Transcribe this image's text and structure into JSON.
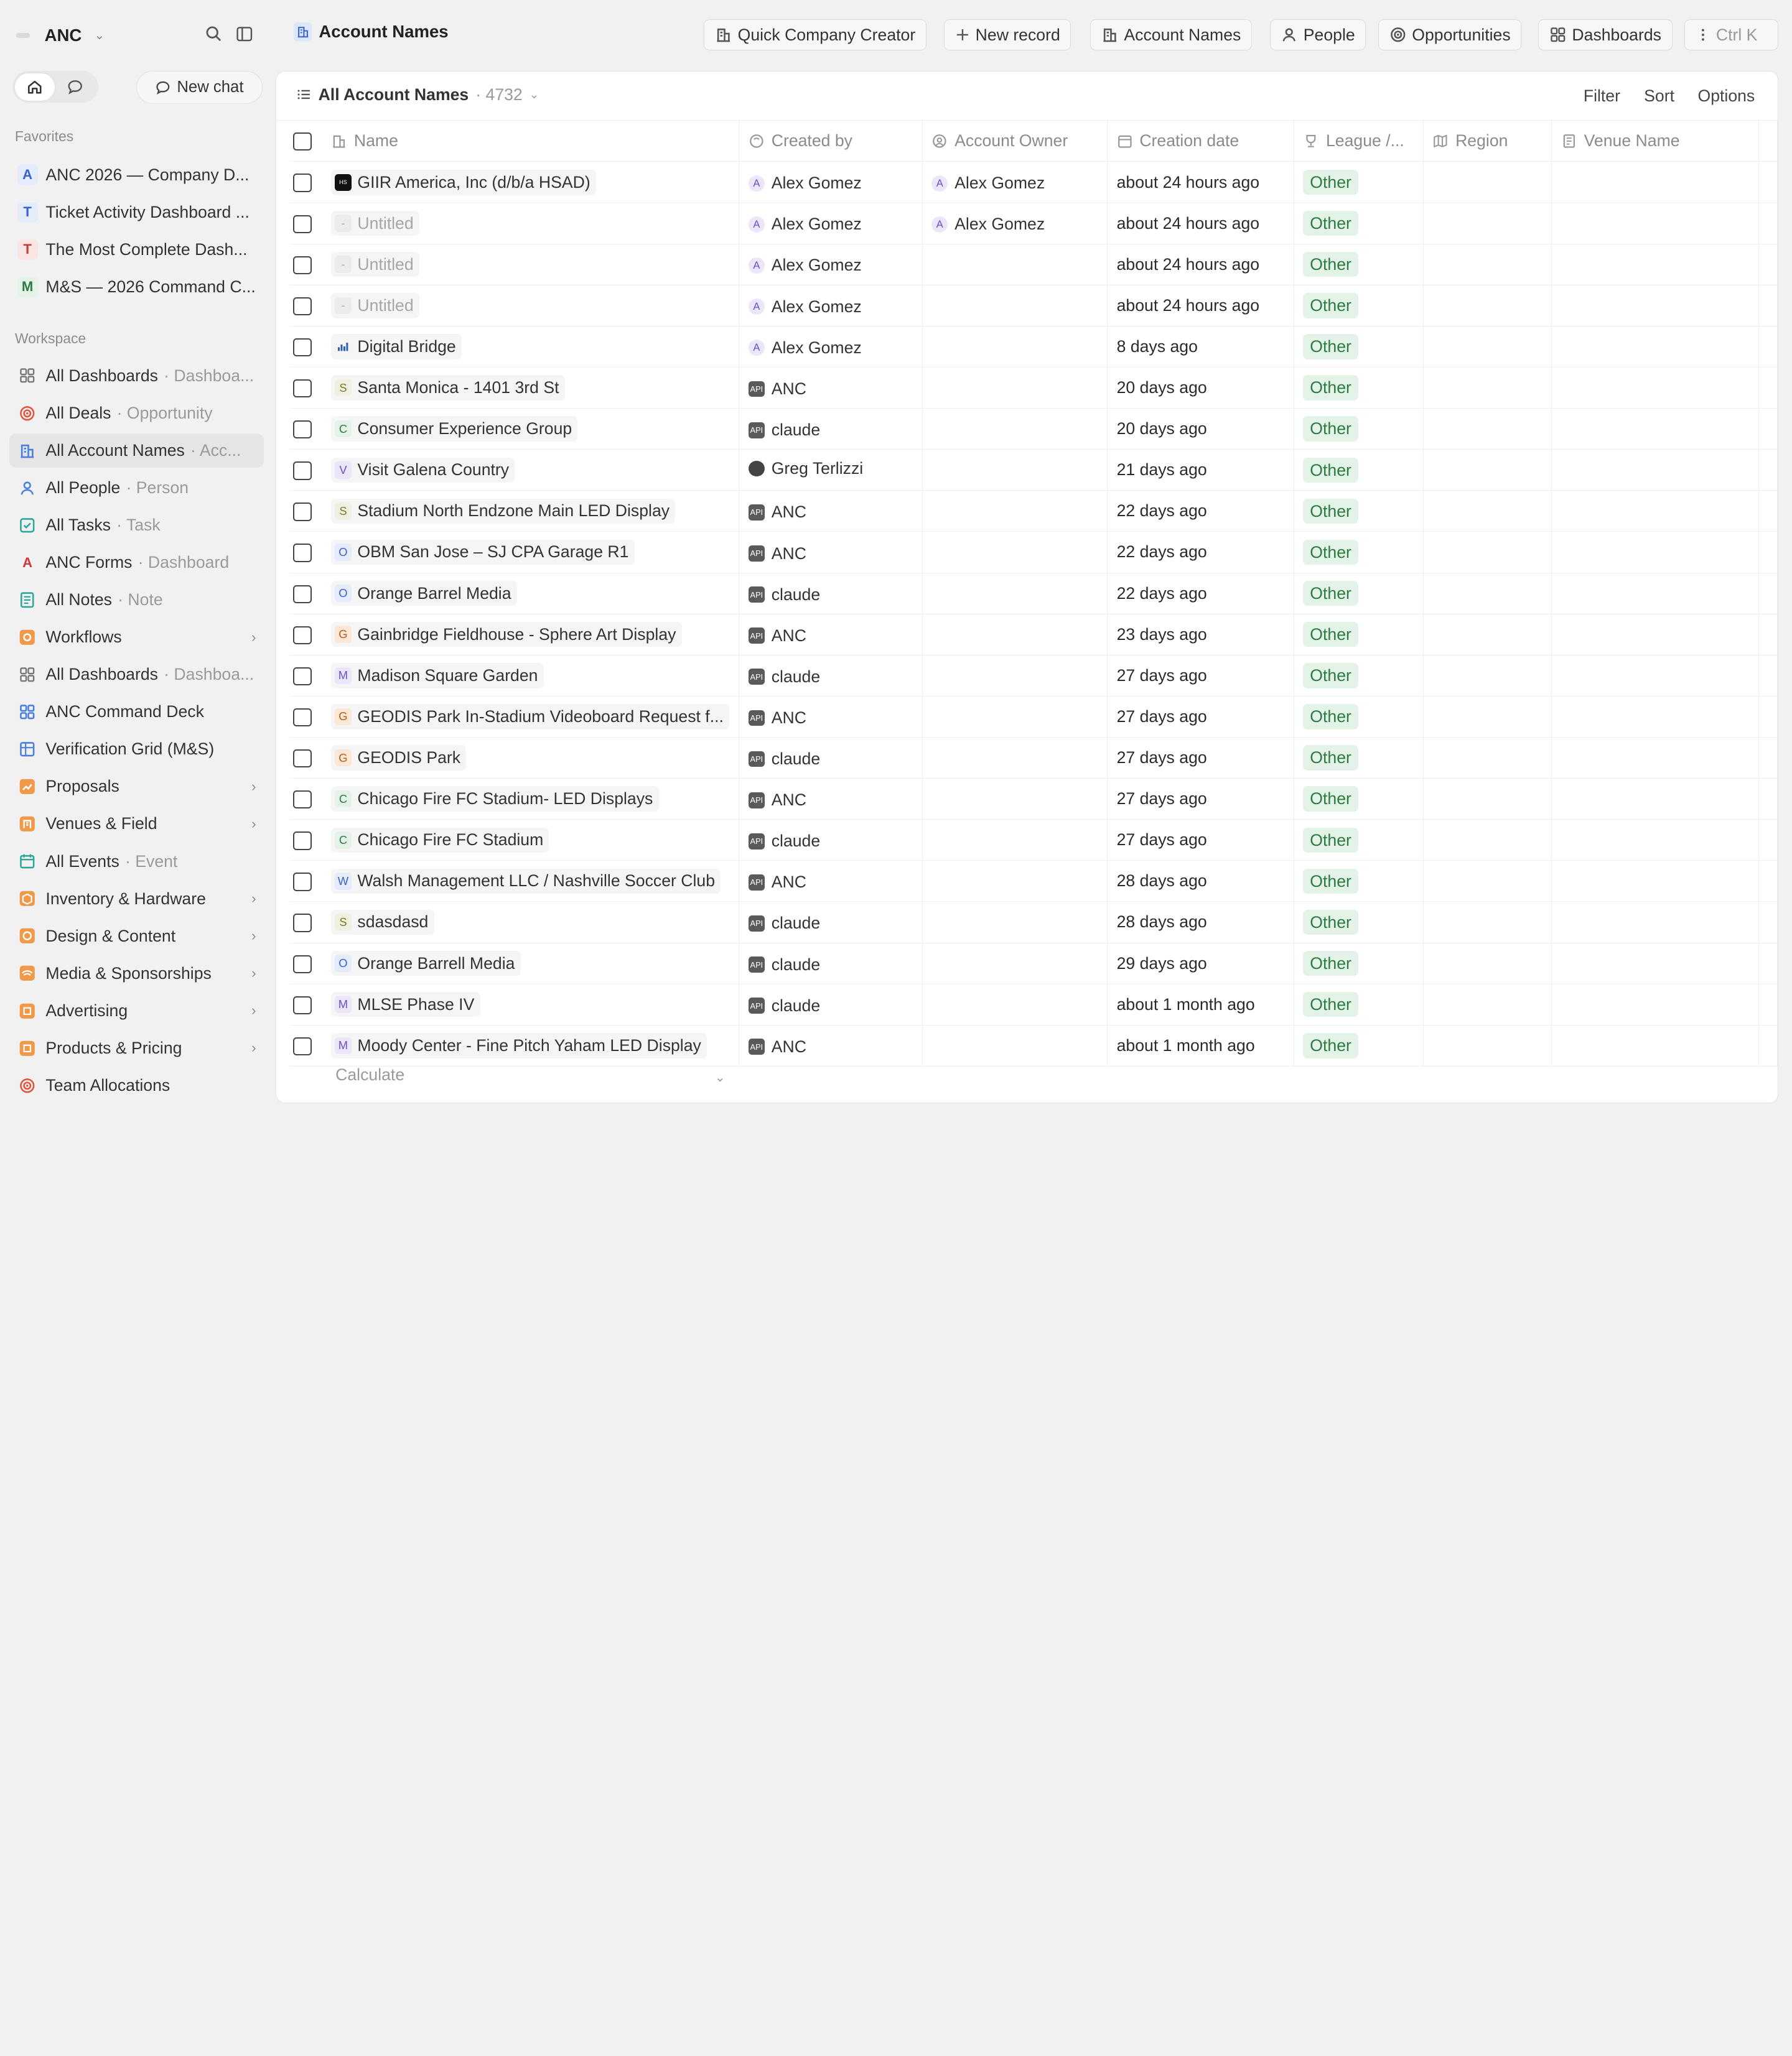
{
  "workspace": {
    "name": "ANC"
  },
  "sidebar": {
    "new_chat": "New chat",
    "favorites_title": "Favorites",
    "favorites": [
      {
        "letter": "A",
        "label": "ANC 2026 — Company D...",
        "bg": "#e4ecfb",
        "fg": "#3a62c9"
      },
      {
        "letter": "T",
        "label": "Ticket Activity Dashboard ...",
        "bg": "#e4ecfb",
        "fg": "#3a62c9"
      },
      {
        "letter": "T",
        "label": "The Most Complete Dash...",
        "bg": "#fbe4e4",
        "fg": "#c93a3a"
      },
      {
        "letter": "M",
        "label": "M&S — 2026 Command C...",
        "bg": "#e4f3e7",
        "fg": "#2d7a43"
      }
    ],
    "workspace_title": "Workspace",
    "items": [
      {
        "icon": "dashboard-icon",
        "label": "All Dashboards",
        "sub": "· Dashboa...",
        "color": "#777"
      },
      {
        "icon": "target-icon",
        "label": "All Deals",
        "sub": "· Opportunity",
        "color": "#e0553f"
      },
      {
        "icon": "building-icon",
        "label": "All Account Names",
        "sub": "· Acc...",
        "color": "#4a7fe0",
        "active": true
      },
      {
        "icon": "person-icon",
        "label": "All People",
        "sub": "· Person",
        "color": "#4a7fe0"
      },
      {
        "icon": "task-icon",
        "label": "All Tasks",
        "sub": "· Task",
        "color": "#2aa89a"
      },
      {
        "icon": "letter-a-icon",
        "label": "ANC Forms",
        "sub": "· Dashboard",
        "color": "#c93a3a"
      },
      {
        "icon": "note-icon",
        "label": "All Notes",
        "sub": "· Note",
        "color": "#2aa89a"
      },
      {
        "icon": "workflow-icon",
        "label": "Workflows",
        "sub": "",
        "color": "#ef8a2b",
        "chev": true
      },
      {
        "icon": "dashboard-icon",
        "label": "All Dashboards",
        "sub": "· Dashboa...",
        "color": "#777"
      },
      {
        "icon": "grid-icon",
        "label": "ANC Command Deck",
        "sub": "",
        "color": "#4a7fe0"
      },
      {
        "icon": "table-icon",
        "label": "Verification Grid (M&S)",
        "sub": "",
        "color": "#4a7fe0"
      },
      {
        "icon": "chart-icon",
        "label": "Proposals",
        "sub": "",
        "color": "#ef8a2b",
        "chev": true
      },
      {
        "icon": "venue-icon",
        "label": "Venues & Field",
        "sub": "",
        "color": "#ef8a2b",
        "chev": true
      },
      {
        "icon": "calendar-icon",
        "label": "All Events",
        "sub": "· Event",
        "color": "#2aa89a"
      },
      {
        "icon": "box-icon",
        "label": "Inventory & Hardware",
        "sub": "",
        "color": "#ef8a2b",
        "chev": true
      },
      {
        "icon": "palette-icon",
        "label": "Design & Content",
        "sub": "",
        "color": "#ef8a2b",
        "chev": true
      },
      {
        "icon": "broadcast-icon",
        "label": "Media & Sponsorships",
        "sub": "",
        "color": "#ef8a2b",
        "chev": true
      },
      {
        "icon": "ad-icon",
        "label": "Advertising",
        "sub": "",
        "color": "#ef8a2b",
        "chev": true
      },
      {
        "icon": "price-icon",
        "label": "Products & Pricing",
        "sub": "",
        "color": "#ef8a2b",
        "chev": true
      },
      {
        "icon": "target-icon",
        "label": "Team Allocations",
        "sub": "",
        "color": "#e0553f"
      }
    ]
  },
  "header": {
    "title": "Account Names",
    "buttons": [
      {
        "name": "quick-company-creator-button",
        "icon": "building-icon",
        "label": "Quick Company Creator"
      },
      {
        "name": "new-record-button",
        "icon": "plus-icon",
        "label": "New record"
      },
      {
        "name": "account-names-button",
        "icon": "building-icon",
        "label": "Account Names"
      },
      {
        "name": "people-button",
        "icon": "person-icon",
        "label": "People"
      },
      {
        "name": "opportunities-button",
        "icon": "target-icon",
        "label": "Opportunities"
      },
      {
        "name": "dashboards-button",
        "icon": "dashboard-icon",
        "label": "Dashboards"
      },
      {
        "name": "command-menu-button",
        "icon": "more-icon",
        "label": "Ctrl K"
      }
    ]
  },
  "view": {
    "title": "All Account Names",
    "count": "· 4732",
    "filter": "Filter",
    "sort": "Sort",
    "options": "Options"
  },
  "table": {
    "columns": [
      "Name",
      "Created by",
      "Account Owner",
      "Creation date",
      "League /...",
      "Region",
      "Venue Name"
    ],
    "rows": [
      {
        "name": "GIIR America, Inc (d/b/a HSAD)",
        "letter": "logo",
        "created_by": "Alex Gomez",
        "cb_type": "a",
        "owner": "Alex Gomez",
        "date": "about 24 hours ago",
        "league": "Other"
      },
      {
        "name": "Untitled",
        "letter": "-",
        "created_by": "Alex Gomez",
        "cb_type": "a",
        "owner": "Alex Gomez",
        "date": "about 24 hours ago",
        "league": "Other",
        "untitled": true
      },
      {
        "name": "Untitled",
        "letter": "-",
        "created_by": "Alex Gomez",
        "cb_type": "a",
        "owner": "",
        "date": "about 24 hours ago",
        "league": "Other",
        "untitled": true
      },
      {
        "name": "Untitled",
        "letter": "-",
        "created_by": "Alex Gomez",
        "cb_type": "a",
        "owner": "",
        "date": "about 24 hours ago",
        "league": "Other",
        "untitled": true
      },
      {
        "name": "Digital Bridge",
        "letter": "bars",
        "created_by": "Alex Gomez",
        "cb_type": "a",
        "owner": "",
        "date": "8 days ago",
        "league": "Other"
      },
      {
        "name": "Santa Monica - 1401 3rd St",
        "letter": "S",
        "created_by": "ANC",
        "cb_type": "api",
        "owner": "",
        "date": "20 days ago",
        "league": "Other"
      },
      {
        "name": "Consumer Experience Group",
        "letter": "C",
        "created_by": "claude",
        "cb_type": "api",
        "owner": "",
        "date": "20 days ago",
        "league": "Other"
      },
      {
        "name": "Visit Galena Country",
        "letter": "V",
        "created_by": "Greg Terlizzi",
        "cb_type": "g",
        "owner": "",
        "date": "21 days ago",
        "league": "Other"
      },
      {
        "name": "Stadium North Endzone Main LED Display",
        "letter": "S",
        "created_by": "ANC",
        "cb_type": "api",
        "owner": "",
        "date": "22 days ago",
        "league": "Other"
      },
      {
        "name": "OBM San Jose – SJ CPA Garage R1",
        "letter": "O",
        "created_by": "ANC",
        "cb_type": "api",
        "owner": "",
        "date": "22 days ago",
        "league": "Other"
      },
      {
        "name": "Orange Barrel Media",
        "letter": "O",
        "created_by": "claude",
        "cb_type": "api",
        "owner": "",
        "date": "22 days ago",
        "league": "Other"
      },
      {
        "name": "Gainbridge Fieldhouse - Sphere Art Display",
        "letter": "G",
        "created_by": "ANC",
        "cb_type": "api",
        "owner": "",
        "date": "23 days ago",
        "league": "Other"
      },
      {
        "name": "Madison Square Garden",
        "letter": "M",
        "created_by": "claude",
        "cb_type": "api",
        "owner": "",
        "date": "27 days ago",
        "league": "Other"
      },
      {
        "name": "GEODIS Park In-Stadium Videoboard Request f...",
        "letter": "G",
        "created_by": "ANC",
        "cb_type": "api",
        "owner": "",
        "date": "27 days ago",
        "league": "Other"
      },
      {
        "name": "GEODIS Park",
        "letter": "G",
        "created_by": "claude",
        "cb_type": "api",
        "owner": "",
        "date": "27 days ago",
        "league": "Other"
      },
      {
        "name": "Chicago Fire FC Stadium- LED Displays",
        "letter": "C",
        "created_by": "ANC",
        "cb_type": "api",
        "owner": "",
        "date": "27 days ago",
        "league": "Other"
      },
      {
        "name": "Chicago Fire FC Stadium",
        "letter": "C",
        "created_by": "claude",
        "cb_type": "api",
        "owner": "",
        "date": "27 days ago",
        "league": "Other"
      },
      {
        "name": "Walsh Management LLC / Nashville Soccer Club",
        "letter": "W",
        "created_by": "ANC",
        "cb_type": "api",
        "owner": "",
        "date": "28 days ago",
        "league": "Other"
      },
      {
        "name": "sdasdasd",
        "letter": "S",
        "created_by": "claude",
        "cb_type": "api",
        "owner": "",
        "date": "28 days ago",
        "league": "Other"
      },
      {
        "name": "Orange Barrell Media",
        "letter": "O",
        "created_by": "claude",
        "cb_type": "api",
        "owner": "",
        "date": "29 days ago",
        "league": "Other"
      },
      {
        "name": "MLSE Phase IV",
        "letter": "M",
        "created_by": "claude",
        "cb_type": "api",
        "owner": "",
        "date": "about 1 month ago",
        "league": "Other"
      },
      {
        "name": "Moody Center - Fine Pitch Yaham LED Display",
        "letter": "M",
        "created_by": "ANC",
        "cb_type": "api",
        "owner": "",
        "date": "about 1 month ago",
        "league": "Other"
      }
    ],
    "calculate": "Calculate"
  },
  "colors": {
    "accent": "#4a7fe0",
    "tag_bg": "#e4f3e7",
    "tag_fg": "#2d7a43",
    "page_bg": "#f1f1f1"
  }
}
